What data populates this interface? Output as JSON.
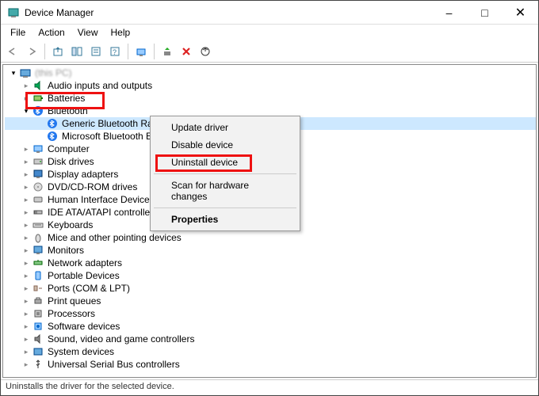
{
  "window": {
    "title": "Device Manager"
  },
  "menubar": [
    "File",
    "Action",
    "View",
    "Help"
  ],
  "root_node": "(this PC)",
  "tree": [
    {
      "label": "Audio inputs and outputs",
      "expanded": false
    },
    {
      "label": "Batteries",
      "expanded": false
    },
    {
      "label": "Bluetooth",
      "expanded": true,
      "children": [
        {
          "label": "Generic Bluetooth Radio",
          "selected": true
        },
        {
          "label": "Microsoft Bluetooth Enumerator"
        }
      ]
    },
    {
      "label": "Computer",
      "expanded": false
    },
    {
      "label": "Disk drives",
      "expanded": false
    },
    {
      "label": "Display adapters",
      "expanded": false
    },
    {
      "label": "DVD/CD-ROM drives",
      "expanded": false
    },
    {
      "label": "Human Interface Devices",
      "expanded": false
    },
    {
      "label": "IDE ATA/ATAPI controllers",
      "expanded": false
    },
    {
      "label": "Keyboards",
      "expanded": false
    },
    {
      "label": "Mice and other pointing devices",
      "expanded": false
    },
    {
      "label": "Monitors",
      "expanded": false
    },
    {
      "label": "Network adapters",
      "expanded": false
    },
    {
      "label": "Portable Devices",
      "expanded": false
    },
    {
      "label": "Ports (COM & LPT)",
      "expanded": false
    },
    {
      "label": "Print queues",
      "expanded": false
    },
    {
      "label": "Processors",
      "expanded": false
    },
    {
      "label": "Software devices",
      "expanded": false
    },
    {
      "label": "Sound, video and game controllers",
      "expanded": false
    },
    {
      "label": "System devices",
      "expanded": false
    },
    {
      "label": "Universal Serial Bus controllers",
      "expanded": false
    }
  ],
  "context_menu": {
    "items": [
      {
        "label": "Update driver"
      },
      {
        "label": "Disable device"
      },
      {
        "label": "Uninstall device",
        "highlighted": true
      },
      {
        "sep": true
      },
      {
        "label": "Scan for hardware changes"
      },
      {
        "sep": true
      },
      {
        "label": "Properties",
        "bold": true
      }
    ]
  },
  "statusbar": "Uninstalls the driver for the selected device.",
  "highlights": {
    "bluetooth_category": true,
    "uninstall_device": true
  }
}
